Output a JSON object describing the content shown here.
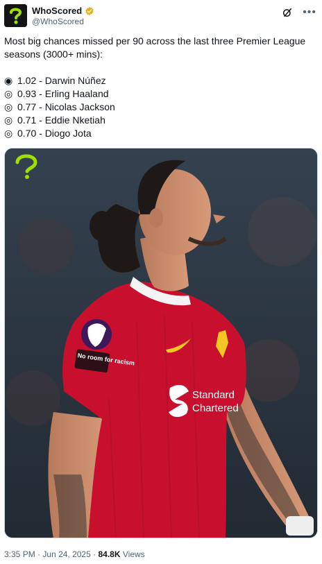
{
  "header": {
    "name": "WhoScored",
    "handle": "@WhoScored"
  },
  "tweet": {
    "intro": "Most big chances missed per 90 across the last three Premier League seasons (3000+ mins):",
    "items": [
      {
        "bullet": "◉",
        "text": "1.02 - Darwin Núñez"
      },
      {
        "bullet": "◎",
        "text": "0.93 - Erling Haaland"
      },
      {
        "bullet": "◎",
        "text": "0.77 - Nicolas Jackson"
      },
      {
        "bullet": "◎",
        "text": "0.71 - Eddie Nketiah"
      },
      {
        "bullet": "◎",
        "text": "0.70 - Diogo Jota"
      }
    ]
  },
  "media": {
    "sponsor_line1": "Standard",
    "sponsor_line2": "Chartered",
    "sleeve_text": "No room for racism"
  },
  "footer": {
    "time": "3:35 PM",
    "sep": "·",
    "date": "Jun 24, 2025",
    "views_count": "84.8K",
    "views_label": "Views"
  },
  "colors": {
    "kit_red": "#c8102e",
    "brand_green": "#9fe000",
    "verified_gold": "#e8b115"
  }
}
